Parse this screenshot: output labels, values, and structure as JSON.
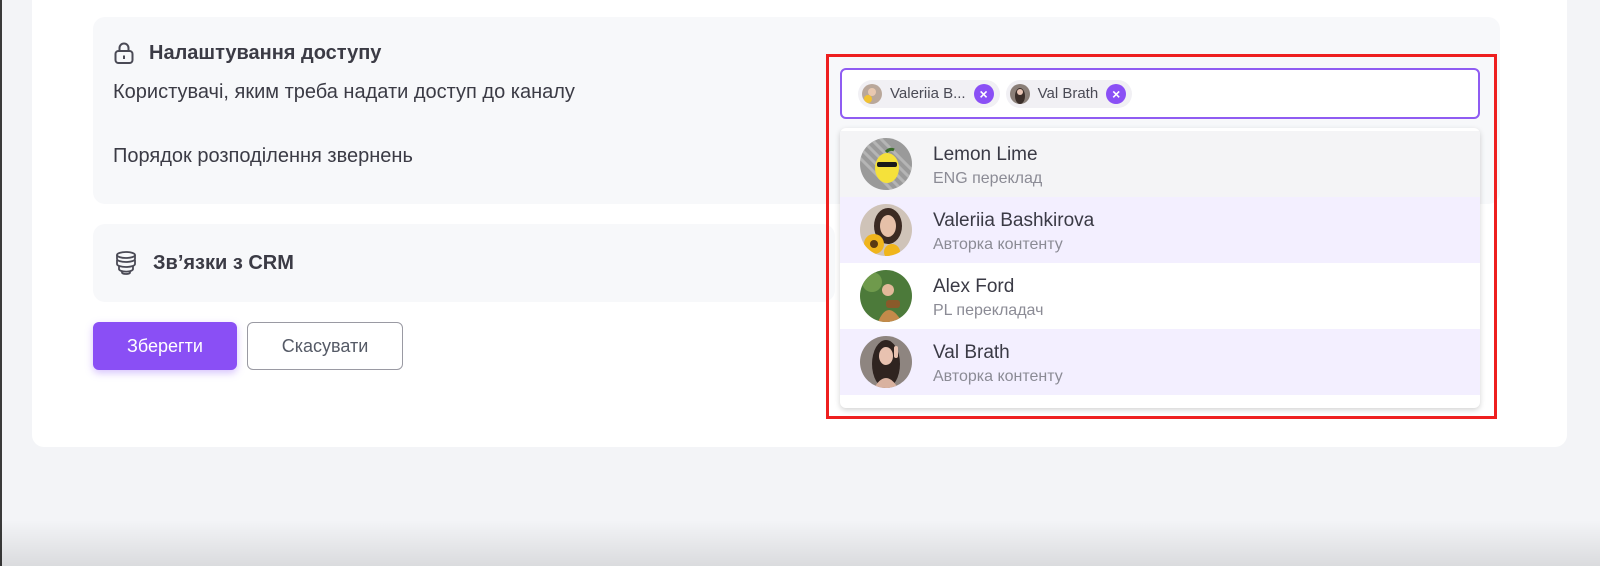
{
  "access_section": {
    "title": "Налаштування доступу",
    "users_label": "Користувачі, яким треба надати доступ до каналу",
    "distribution_label": "Порядок розподілення звернень"
  },
  "crm_section": {
    "title": "Зв’язки з CRM"
  },
  "buttons": {
    "save": "Зберегти",
    "cancel": "Скасувати"
  },
  "user_select": {
    "selected_chips": [
      {
        "label": "Valeriia B...",
        "remove_icon": "close-icon"
      },
      {
        "label": "Val Brath",
        "remove_icon": "close-icon"
      }
    ],
    "options": [
      {
        "name": "Lemon Lime",
        "role": "ENG переклад"
      },
      {
        "name": "Valeriia Bashkirova",
        "role": "Авторка контенту"
      },
      {
        "name": "Alex Ford",
        "role": "PL перекладач"
      },
      {
        "name": "Val Brath",
        "role": "Авторка контенту"
      }
    ]
  },
  "colors": {
    "accent": "#8a4ff5",
    "highlight_border": "#ee1f1f",
    "selected_option_bg": "#f3efff"
  }
}
